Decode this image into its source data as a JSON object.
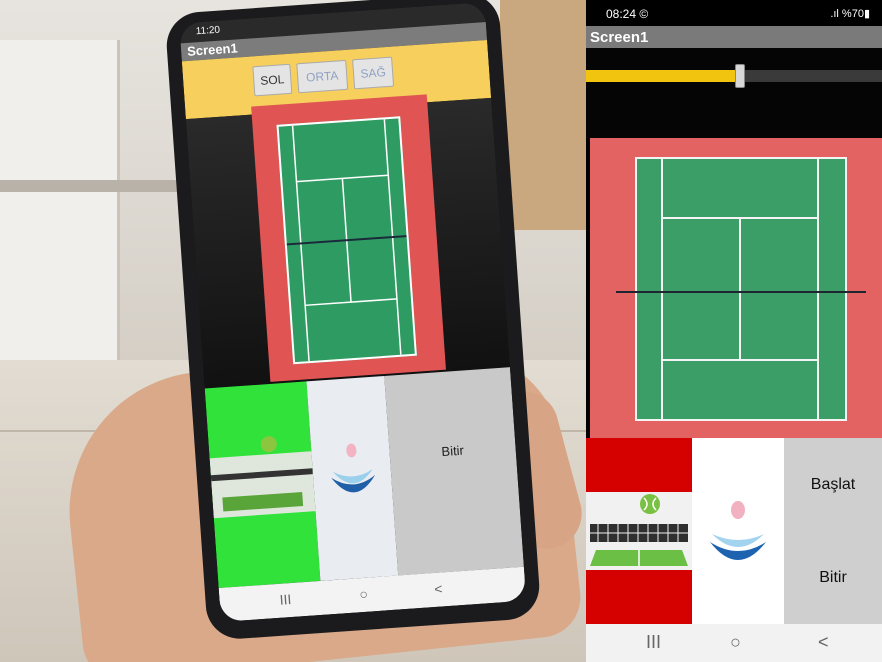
{
  "photo_phone": {
    "status_time": "11:20",
    "title": "Screen1",
    "buttons": [
      "SOL",
      "ORTA",
      "SAĞ"
    ],
    "tile_label": "Bitir",
    "nav": [
      "III",
      "○",
      "<"
    ]
  },
  "app": {
    "status": {
      "time": "08:24 ©",
      "battery": ".ıl %70▮"
    },
    "title": "Screen1",
    "slider": {
      "value_fraction": 0.52
    },
    "buttons": {
      "start": "Başlat",
      "end": "Bitir"
    },
    "nav": {
      "recents": "III",
      "home": "○",
      "back": "<"
    }
  },
  "colors": {
    "accent_slider": "#f1c40f",
    "court_surface": "#2e9c62",
    "court_surround": "#e36363",
    "tile_red": "#d50000",
    "title_bar": "#7a7a7a"
  },
  "icons": {
    "tennis_scene": "tennis-net-ball-icon",
    "figure_logo": "person-swoosh-logo-icon"
  }
}
